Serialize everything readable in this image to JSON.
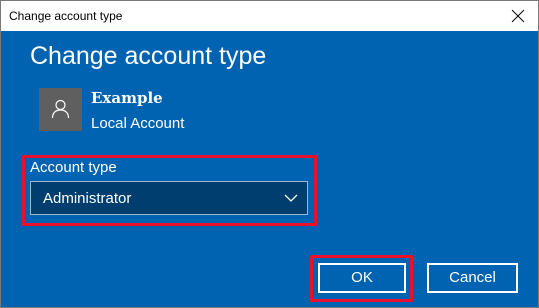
{
  "window": {
    "title": "Change account type"
  },
  "dialog": {
    "heading": "Change account type",
    "user": {
      "name": "Example",
      "type": "Local Account",
      "avatar_icon": "person-icon"
    },
    "account_type": {
      "label": "Account type",
      "selected": "Administrator"
    },
    "buttons": {
      "ok_label": "OK",
      "cancel_label": "Cancel"
    }
  },
  "colors": {
    "dialog_background": "#0063b1",
    "select_background": "#003e70",
    "avatar_background": "#5f5f5f",
    "highlight": "#e8112d",
    "text": "#ffffff"
  }
}
